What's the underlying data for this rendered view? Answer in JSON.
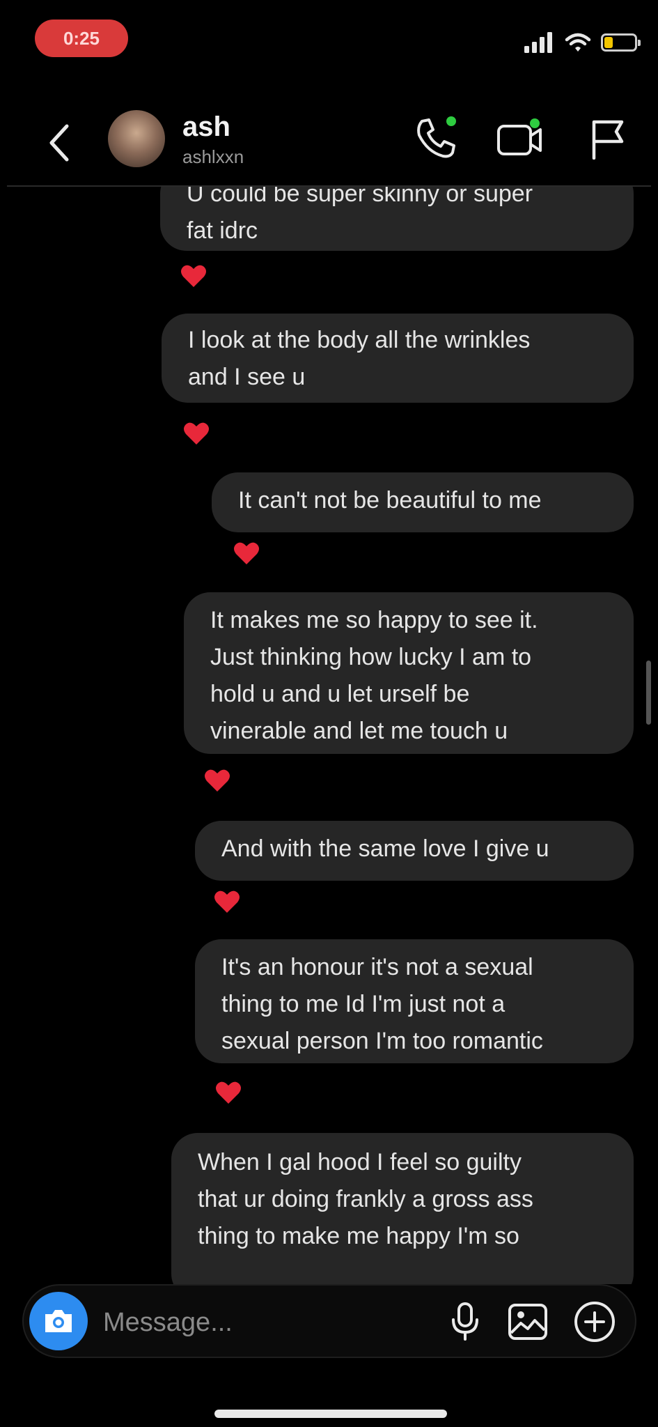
{
  "status_bar": {
    "recording_label": "0:25",
    "battery_color": "#f2c500",
    "battery_level": 0.25
  },
  "header": {
    "name": "ash",
    "username": "ashlxxn",
    "icons": [
      "back-icon",
      "phone-icon",
      "video-icon",
      "flag-icon"
    ],
    "active_dot_color": "#2ecc40"
  },
  "messages": [
    {
      "text": "U could be super skinny or super\nfat idrc",
      "reaction": "heart"
    },
    {
      "text": "I look at the body all the wrinkles\nand I see u",
      "reaction": "heart"
    },
    {
      "text": "It can't not be beautiful to me",
      "reaction": "heart"
    },
    {
      "text": "It makes me so happy to see it.\nJust thinking how lucky I am to\nhold u and u let urself be\nvinerable and let me touch u",
      "reaction": "heart"
    },
    {
      "text": "And with the same love I give u",
      "reaction": "heart"
    },
    {
      "text": "It's an honour it's not a sexual\nthing to me Id I'm just not a\nsexual person I'm too romantic",
      "reaction": "heart"
    },
    {
      "text": "When I gal hood I feel so guilty\nthat ur doing frankly a gross ass\nthing to make me happy I'm so",
      "reaction": ""
    }
  ],
  "composer": {
    "placeholder": "Message...",
    "accent_color": "#2d8cf0",
    "icons": [
      "camera-icon",
      "microphone-icon",
      "image-icon",
      "plus-circle-icon"
    ]
  },
  "colors": {
    "background": "#000000",
    "bubble": "#262626",
    "heart": "#e8283a"
  }
}
